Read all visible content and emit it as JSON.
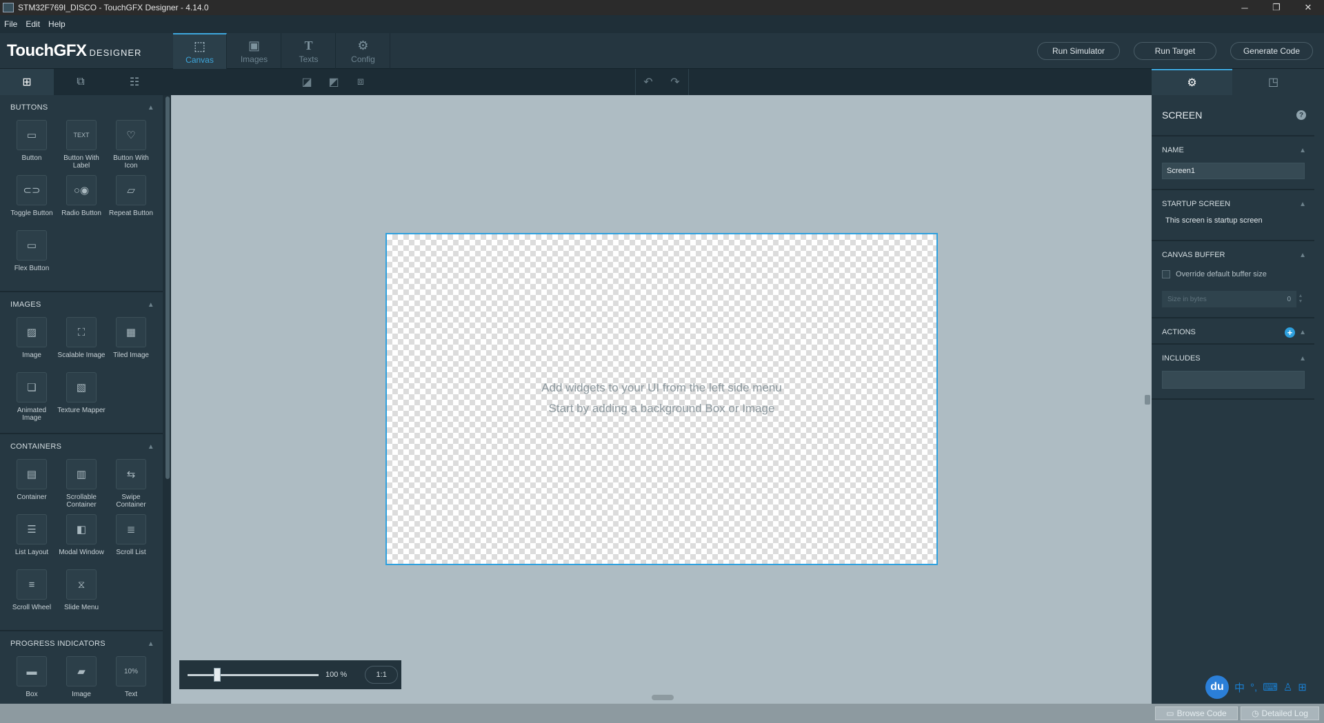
{
  "window": {
    "title": "STM32F769I_DISCO - TouchGFX Designer - 4.14.0"
  },
  "menu": [
    "File",
    "Edit",
    "Help"
  ],
  "logo": {
    "brand": "TouchGFX",
    "suffix": "DESIGNER"
  },
  "main_tabs": [
    {
      "label": "Canvas",
      "icon": "canvas-icon",
      "active": true
    },
    {
      "label": "Images",
      "icon": "images-icon"
    },
    {
      "label": "Texts",
      "icon": "texts-icon"
    },
    {
      "label": "Config",
      "icon": "config-icon"
    }
  ],
  "top_buttons": {
    "run_simulator": "Run Simulator",
    "run_target": "Run Target",
    "generate_code": "Generate Code"
  },
  "left_sections": [
    {
      "title": "BUTTONS",
      "items": [
        "Button",
        "Button With Label",
        "Button With Icon",
        "Toggle Button",
        "Radio Button",
        "Repeat Button",
        "Flex Button"
      ]
    },
    {
      "title": "IMAGES",
      "items": [
        "Image",
        "Scalable Image",
        "Tiled Image",
        "Animated Image",
        "Texture Mapper"
      ]
    },
    {
      "title": "CONTAINERS",
      "items": [
        "Container",
        "Scrollable Container",
        "Swipe Container",
        "List Layout",
        "Modal Window",
        "Scroll List",
        "Scroll Wheel",
        "Slide Menu"
      ]
    },
    {
      "title": "PROGRESS INDICATORS",
      "items": [
        "Box",
        "Image",
        "Text"
      ]
    }
  ],
  "canvas": {
    "hint_line1": "Add widgets to your UI from the left side menu",
    "hint_line2": "Start by adding a background Box or Image"
  },
  "zoom": {
    "value_label": "100 %",
    "value": 100,
    "reset_label": "1:1"
  },
  "properties": {
    "title": "SCREEN",
    "name_label": "NAME",
    "name_value": "Screen1",
    "startup_label": "STARTUP SCREEN",
    "startup_text": "This screen is startup screen",
    "buffer_label": "CANVAS BUFFER",
    "override_label": "Override default buffer size",
    "size_placeholder": "Size in bytes",
    "size_value": "0",
    "actions_label": "ACTIONS",
    "includes_label": "INCLUDES"
  },
  "status": {
    "browse_code": "Browse Code",
    "detailed_log": "Detailed Log"
  },
  "ime": {
    "logo": "du",
    "lang": "中"
  },
  "colors": {
    "accent": "#3ea7dd",
    "canvas_bg": "#aebcc3",
    "panel": "#263842"
  }
}
